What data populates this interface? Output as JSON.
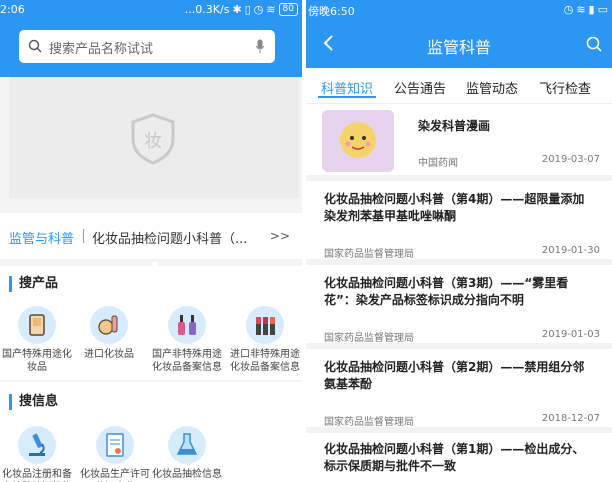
{
  "left": {
    "status": {
      "time": "2:06",
      "network_speed": "...0.3K/s",
      "battery": "80"
    },
    "search": {
      "placeholder": "搜索产品名称试试"
    },
    "news_bar": {
      "tag": "监管与科普",
      "text": "化妆品抽检问题小科普（...",
      "more": ">>"
    },
    "sections": [
      {
        "title": "搜产品",
        "items": [
          {
            "label": "国产特殊用途化妆品",
            "icon": "makeup-palette-icon"
          },
          {
            "label": "进口化妆品",
            "icon": "cosmetics-icon"
          },
          {
            "label": "国产非特殊用途化妆品备案信息",
            "icon": "nail-polish-icon"
          },
          {
            "label": "进口非特殊用途化妆品备案信息",
            "icon": "lipstick-icon"
          }
        ]
      },
      {
        "title": "搜信息",
        "items": [
          {
            "label": "化妆品注册和备案检验检测机构",
            "icon": "microscope-icon"
          },
          {
            "label": "化妆品生产许可获证企业",
            "icon": "license-icon"
          },
          {
            "label": "化妆品抽检信息",
            "icon": "flask-icon"
          }
        ]
      }
    ]
  },
  "right": {
    "status": {
      "time": "傍晚6:50"
    },
    "title": "监管科普",
    "tabs": [
      "科普知识",
      "公告通告",
      "监管动态",
      "飞行检查"
    ],
    "active_tab": 0,
    "articles": [
      {
        "title": "染发科普漫画",
        "source": "中国药闻",
        "date": "2019-03-07"
      },
      {
        "title": "化妆品抽检问题小科普（第4期）——超限量添加染发剂苯基甲基吡唑啉酮",
        "source": "国家药品监督管理局",
        "date": "2019-01-30"
      },
      {
        "title": "化妆品抽检问题小科普（第3期）——“雾里看花”：染发产品标签标识成分指向不明",
        "source": "国家药品监督管理局",
        "date": "2019-01-03"
      },
      {
        "title": "化妆品抽检问题小科普（第2期）——禁用组分邻氨基苯酚",
        "source": "国家药品监督管理局",
        "date": "2018-12-07"
      },
      {
        "title": "化妆品抽检问题小科普（第1期）——检出成分、标示保质期与批件不一致",
        "source": "",
        "date": ""
      }
    ]
  },
  "colors": {
    "accent": "#2b97f2",
    "icon_bg": "#d6ebfb"
  }
}
